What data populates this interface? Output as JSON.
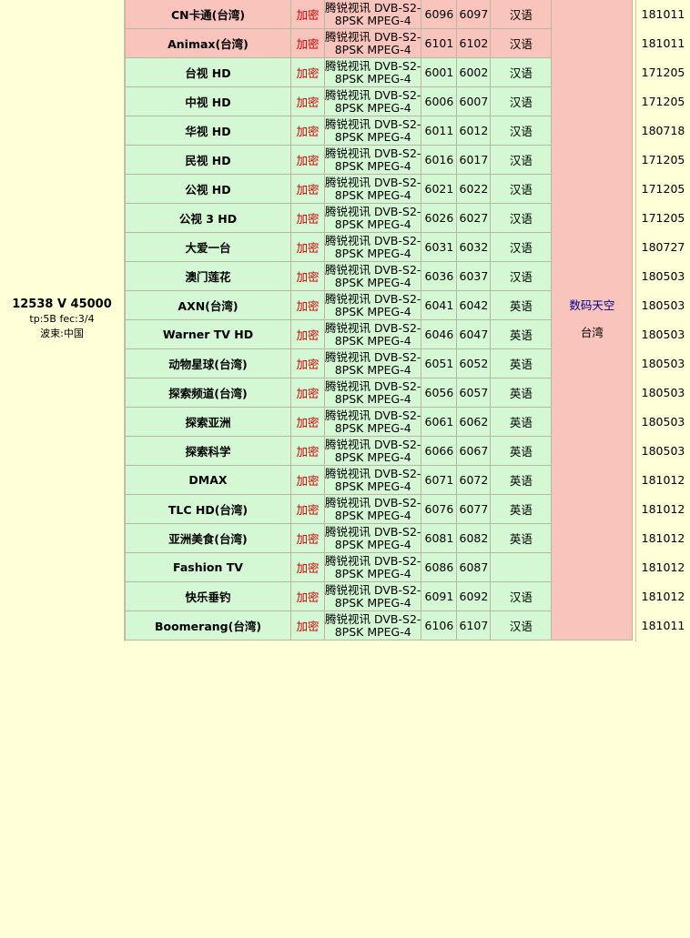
{
  "transponder": {
    "frequency": "12538 V 45000",
    "tp_fec": "tp:5B  fec:3/4",
    "beam": "波束:中国"
  },
  "package": {
    "name": "数码天空",
    "region": "台湾"
  },
  "system_line1": "腾锐视讯 DVB-S2-",
  "system_line2": "8PSK MPEG-4",
  "encryption": "加密",
  "channels": [
    {
      "name": "CN卡通(台湾)",
      "vpid": "6096",
      "apid": "6097",
      "lang": "汉语",
      "date": "181011",
      "style": "pink"
    },
    {
      "name": "Animax(台湾)",
      "vpid": "6101",
      "apid": "6102",
      "lang": "汉语",
      "date": "181011",
      "style": "pink"
    },
    {
      "name": "台视 HD",
      "vpid": "6001",
      "apid": "6002",
      "lang": "汉语",
      "date": "171205",
      "style": "green"
    },
    {
      "name": "中视 HD",
      "vpid": "6006",
      "apid": "6007",
      "lang": "汉语",
      "date": "171205",
      "style": "green"
    },
    {
      "name": "华视 HD",
      "vpid": "6011",
      "apid": "6012",
      "lang": "汉语",
      "date": "180718",
      "style": "green"
    },
    {
      "name": "民视 HD",
      "vpid": "6016",
      "apid": "6017",
      "lang": "汉语",
      "date": "171205",
      "style": "green"
    },
    {
      "name": "公视 HD",
      "vpid": "6021",
      "apid": "6022",
      "lang": "汉语",
      "date": "171205",
      "style": "green"
    },
    {
      "name": "公视 3 HD",
      "vpid": "6026",
      "apid": "6027",
      "lang": "汉语",
      "date": "171205",
      "style": "green"
    },
    {
      "name": "大爱一台",
      "vpid": "6031",
      "apid": "6032",
      "lang": "汉语",
      "date": "180727",
      "style": "green"
    },
    {
      "name": "澳门莲花",
      "vpid": "6036",
      "apid": "6037",
      "lang": "汉语",
      "date": "180503",
      "style": "green"
    },
    {
      "name": "AXN(台湾)",
      "vpid": "6041",
      "apid": "6042",
      "lang": "英语",
      "date": "180503",
      "style": "green"
    },
    {
      "name": "Warner TV HD",
      "vpid": "6046",
      "apid": "6047",
      "lang": "英语",
      "date": "180503",
      "style": "green"
    },
    {
      "name": "动物星球(台湾)",
      "vpid": "6051",
      "apid": "6052",
      "lang": "英语",
      "date": "180503",
      "style": "green"
    },
    {
      "name": "探索频道(台湾)",
      "vpid": "6056",
      "apid": "6057",
      "lang": "英语",
      "date": "180503",
      "style": "green"
    },
    {
      "name": "探索亚洲",
      "vpid": "6061",
      "apid": "6062",
      "lang": "英语",
      "date": "180503",
      "style": "green"
    },
    {
      "name": "探索科学",
      "vpid": "6066",
      "apid": "6067",
      "lang": "英语",
      "date": "180503",
      "style": "green"
    },
    {
      "name": "DMAX",
      "vpid": "6071",
      "apid": "6072",
      "lang": "英语",
      "date": "181012",
      "style": "green"
    },
    {
      "name": "TLC HD(台湾)",
      "vpid": "6076",
      "apid": "6077",
      "lang": "英语",
      "date": "181012",
      "style": "green"
    },
    {
      "name": "亚洲美食(台湾)",
      "vpid": "6081",
      "apid": "6082",
      "lang": "英语",
      "date": "181012",
      "style": "green"
    },
    {
      "name": "Fashion TV",
      "vpid": "6086",
      "apid": "6087",
      "lang": "",
      "date": "181012",
      "style": "green"
    },
    {
      "name": "快乐垂钓",
      "vpid": "6091",
      "apid": "6092",
      "lang": "汉语",
      "date": "181012",
      "style": "green"
    },
    {
      "name": "Boomerang(台湾)",
      "vpid": "6106",
      "apid": "6107",
      "lang": "汉语",
      "date": "181011",
      "style": "green"
    }
  ]
}
